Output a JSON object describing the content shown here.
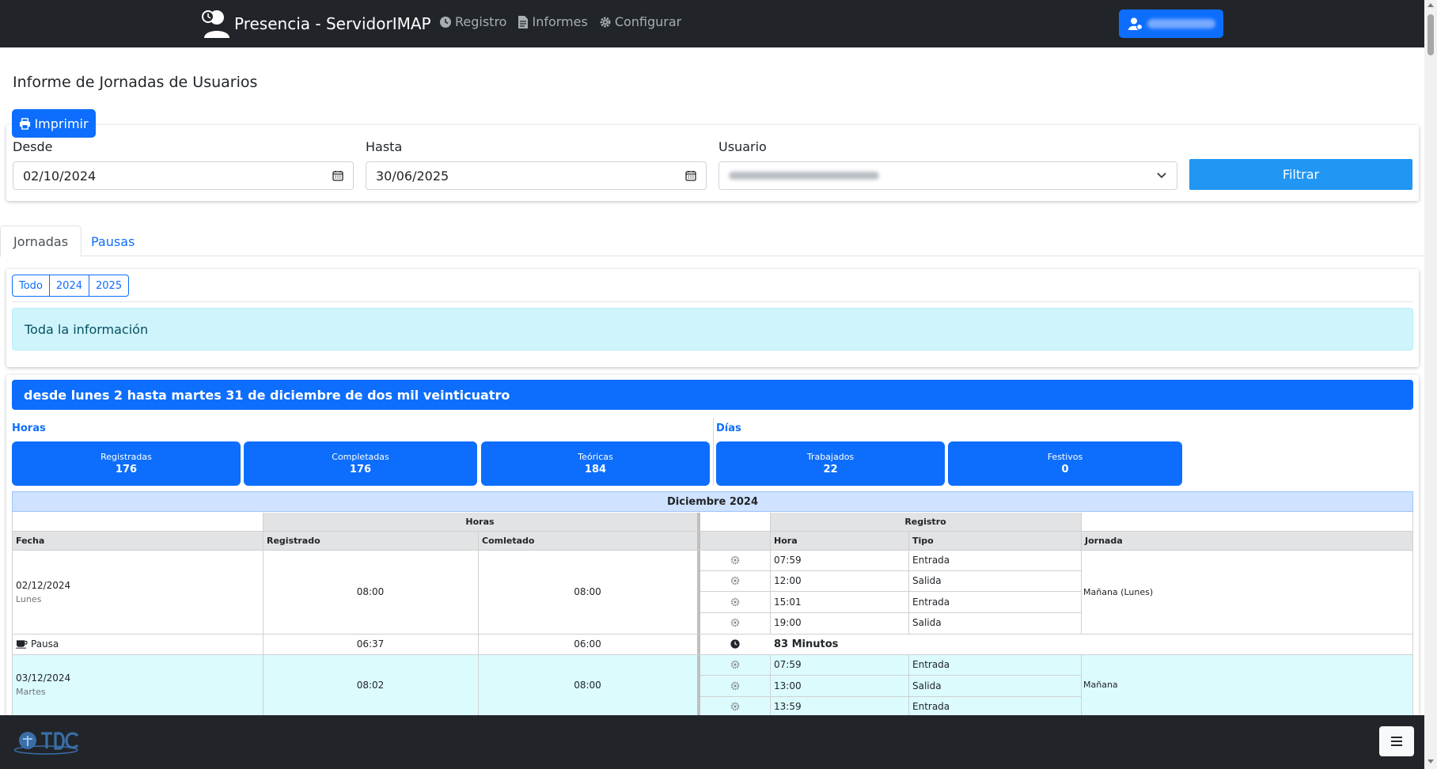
{
  "navbar": {
    "brand": "Presencia - ServidorIMAP",
    "links": [
      {
        "label": "Registro",
        "icon": "clock-icon"
      },
      {
        "label": "Informes",
        "icon": "document-icon"
      },
      {
        "label": "Configurar",
        "icon": "gear-icon"
      }
    ],
    "user_icon": "user-gear-icon"
  },
  "page": {
    "title": "Informe de Jornadas de Usuarios"
  },
  "filters": {
    "print_label": "Imprimir",
    "desde_label": "Desde",
    "desde_value": "02/10/2024",
    "hasta_label": "Hasta",
    "hasta_value": "30/06/2025",
    "usuario_label": "Usuario",
    "filter_label": "Filtrar"
  },
  "tabs": [
    {
      "label": "Jornadas",
      "active": true
    },
    {
      "label": "Pausas",
      "active": false
    }
  ],
  "years": [
    "Todo",
    "2024",
    "2025"
  ],
  "info": "Toda la información",
  "range_title": "desde lunes 2 hasta martes 31 de diciembre de dos mil veinticuatro",
  "stats": {
    "horas_label": "Horas",
    "dias_label": "Días",
    "items": [
      {
        "label": "Registradas",
        "value": "176"
      },
      {
        "label": "Completadas",
        "value": "176"
      },
      {
        "label": "Teóricas",
        "value": "184"
      },
      {
        "label": "Trabajados",
        "value": "22"
      },
      {
        "label": "Festivos",
        "value": "0"
      }
    ]
  },
  "table": {
    "month": "Diciembre 2024",
    "group_horas": "Horas",
    "group_registro": "Registro",
    "columns": {
      "fecha": "Fecha",
      "registrado": "Registrado",
      "completado": "Comletado",
      "hora": "Hora",
      "tipo": "Tipo",
      "jornada": "Jornada"
    },
    "days": [
      {
        "fecha": "02/12/2024",
        "dia": "Lunes",
        "registrado": "08:00",
        "completado": "08:00",
        "jornada": "Mañana (Lunes)",
        "registros": [
          {
            "hora": "07:59",
            "tipo": "Entrada"
          },
          {
            "hora": "12:00",
            "tipo": "Salida"
          },
          {
            "hora": "15:01",
            "tipo": "Entrada"
          },
          {
            "hora": "19:00",
            "tipo": "Salida"
          }
        ],
        "pausa": {
          "label": "Pausa",
          "registrado": "06:37",
          "completado": "06:00",
          "minutos": "83 Minutos"
        }
      },
      {
        "fecha": "03/12/2024",
        "dia": "Martes",
        "registrado": "08:02",
        "completado": "08:00",
        "jornada": "Mañana",
        "registros": [
          {
            "hora": "07:59",
            "tipo": "Entrada"
          },
          {
            "hora": "13:00",
            "tipo": "Salida"
          },
          {
            "hora": "13:59",
            "tipo": "Entrada"
          }
        ]
      }
    ]
  },
  "colors": {
    "primary": "#0d6efd",
    "filter_button": "#2196f3",
    "navbar": "#212529",
    "info_bg": "#cff4fc",
    "row_highlight": "#dcfbfd",
    "month_header": "#cfe2ff"
  }
}
